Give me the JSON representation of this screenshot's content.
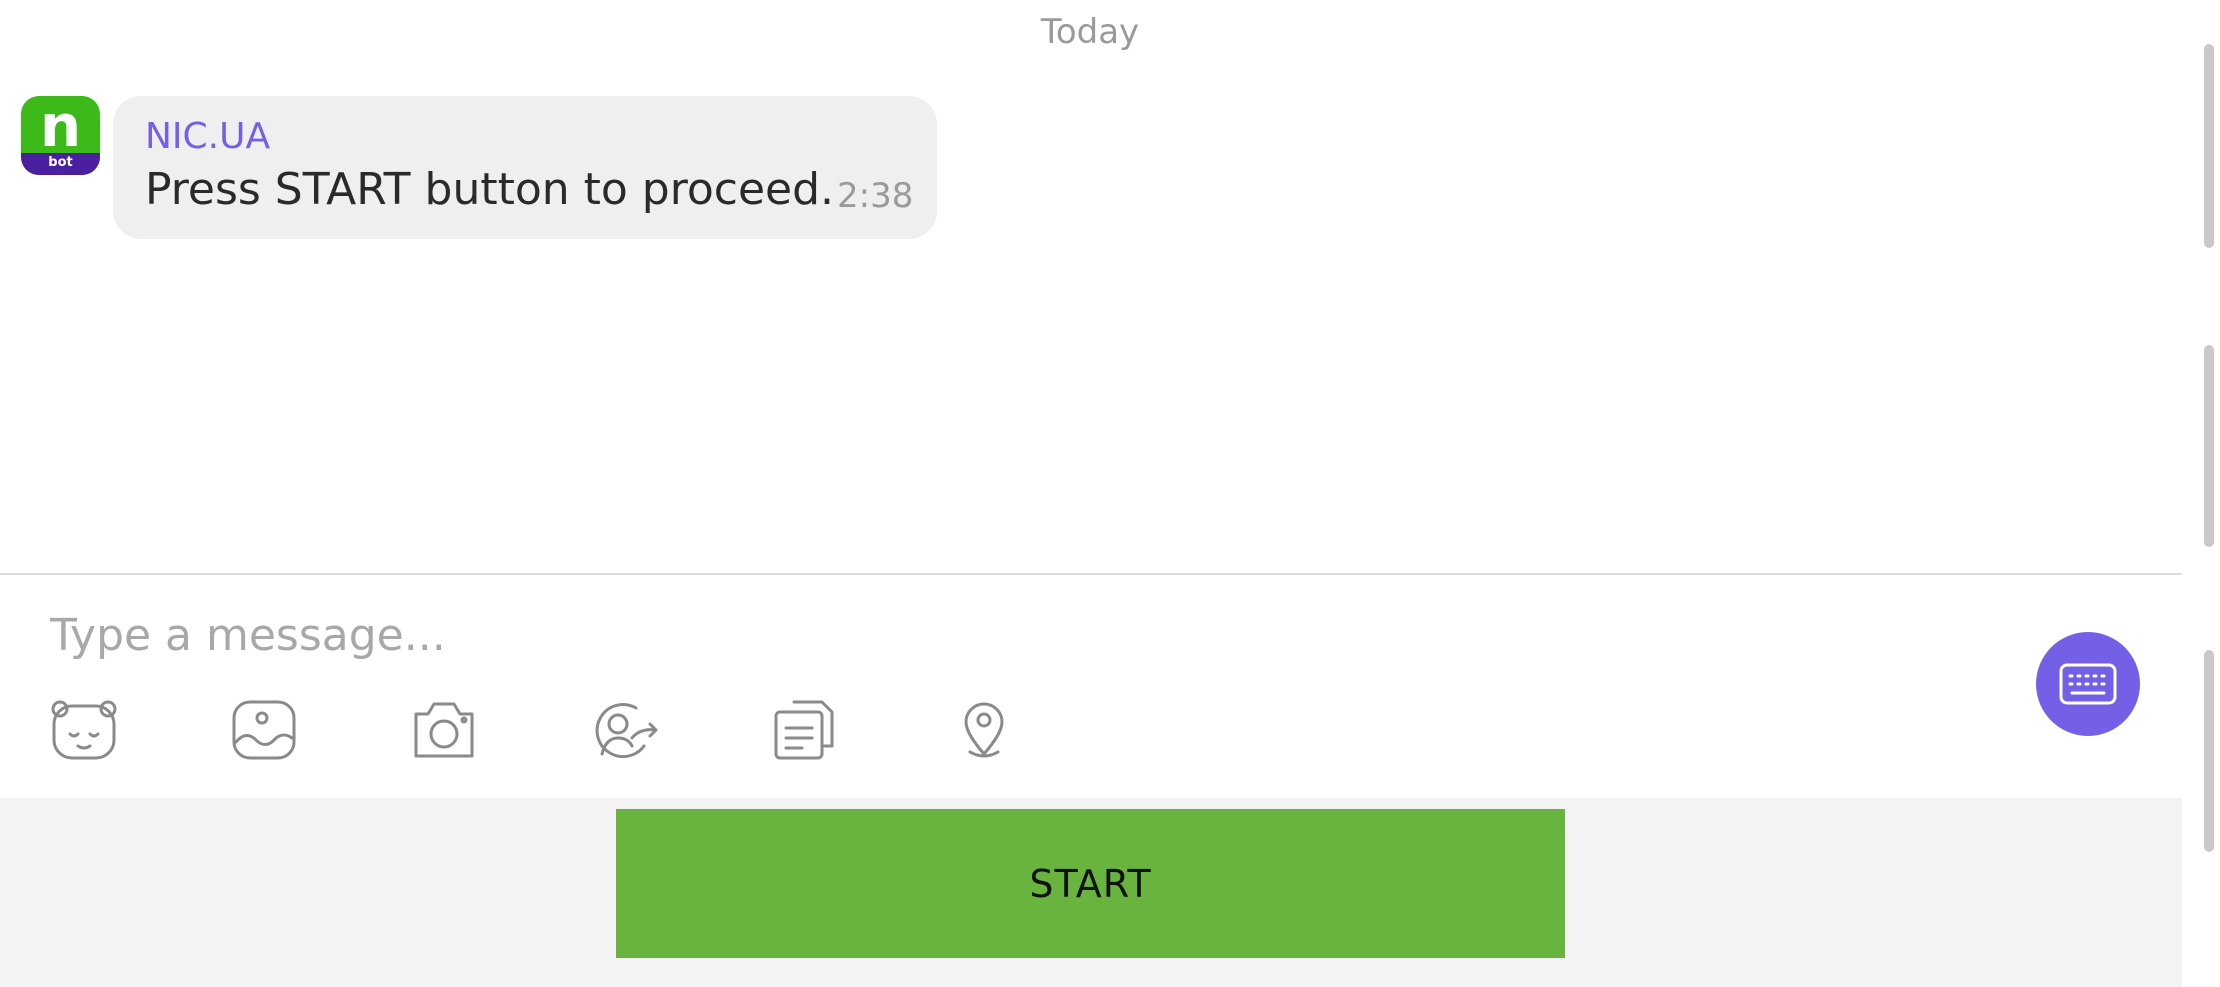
{
  "chat": {
    "date_divider": "Today",
    "messages": [
      {
        "avatar_letter": "n",
        "avatar_badge": "bot",
        "sender": "NIC.UA",
        "text": "Press START button to proceed.",
        "time": "2:38"
      }
    ]
  },
  "composer": {
    "placeholder": "Type a message...",
    "toolbar_icons": [
      "sticker-icon",
      "gallery-icon",
      "camera-icon",
      "share-contact-icon",
      "file-icon",
      "location-icon"
    ],
    "keyboard_icon": "keyboard-icon"
  },
  "bot_keyboard": {
    "start_label": "START"
  },
  "colors": {
    "accent": "#7360e6",
    "avatar_green": "#3cba1a",
    "avatar_purple": "#4a1fa0",
    "start_button": "#69b33f",
    "bubble": "#efefef",
    "panel": "#f3f3f3"
  }
}
